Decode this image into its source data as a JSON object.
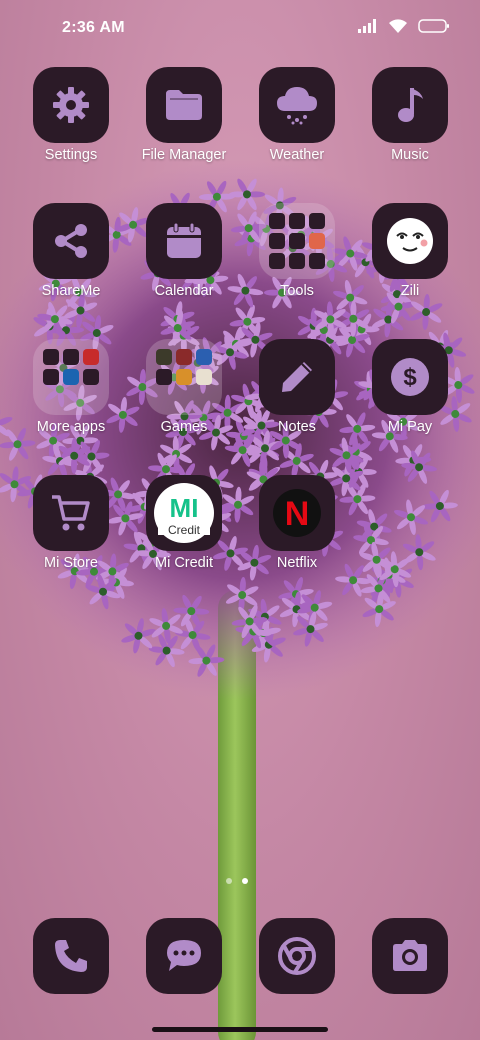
{
  "status_bar": {
    "time": "2:36 AM",
    "icons": [
      "signal-icon",
      "wifi-icon",
      "battery-icon"
    ]
  },
  "apps": [
    {
      "label": "Settings",
      "icon": "gear-icon"
    },
    {
      "label": "File Manager",
      "icon": "folder-icon"
    },
    {
      "label": "Weather",
      "icon": "cloud-icon"
    },
    {
      "label": "Music",
      "icon": "music-note-icon"
    },
    {
      "label": "ShareMe",
      "icon": "share-icon"
    },
    {
      "label": "Calendar",
      "icon": "calendar-icon"
    },
    {
      "label": "Tools",
      "icon": "folder-icon"
    },
    {
      "label": "Zili",
      "icon": "smiley-face-icon"
    },
    {
      "label": "More apps",
      "icon": "folder-icon"
    },
    {
      "label": "Games",
      "icon": "folder-icon"
    },
    {
      "label": "Notes",
      "icon": "pencil-icon"
    },
    {
      "label": "Mi Pay",
      "icon": "dollar-icon"
    },
    {
      "label": "Mi Store",
      "icon": "cart-icon"
    },
    {
      "label": "Mi Credit",
      "icon": "mi-credit-logo-icon"
    },
    {
      "label": "Netflix",
      "icon": "netflix-logo-icon"
    }
  ],
  "logos": {
    "mi_credit": "MI",
    "netflix": "N"
  },
  "page_indicator": {
    "pages": 2,
    "current": 2
  },
  "dock": [
    {
      "icon": "phone-icon"
    },
    {
      "icon": "message-icon"
    },
    {
      "icon": "chrome-icon"
    },
    {
      "icon": "camera-icon"
    }
  ],
  "colors": {
    "icon_tile": "#2b1a27",
    "icon_glyph": "#b18bc8",
    "wallpaper": "#c48aa7",
    "netflix_red": "#e50914",
    "mi_credit_green": "#16c28a"
  }
}
